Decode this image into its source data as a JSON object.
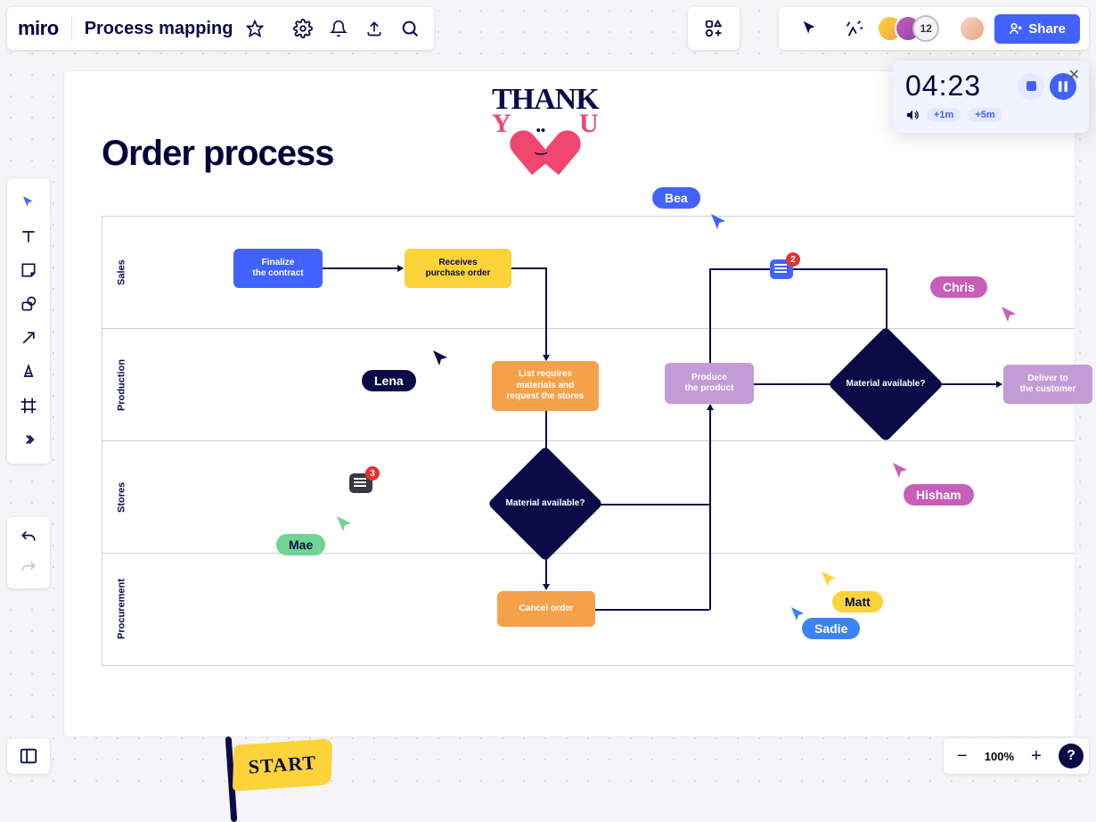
{
  "header": {
    "logo": "miro",
    "board_name": "Process mapping"
  },
  "collab": {
    "avatar_count": "12",
    "share_label": "Share"
  },
  "timer": {
    "digits": "04:23",
    "add1": "+1m",
    "add5": "+5m"
  },
  "zoom": {
    "percent": "100%"
  },
  "board": {
    "title": "Order process",
    "lanes": [
      "Sales",
      "Production",
      "Stores",
      "Procurement"
    ],
    "nodes": {
      "finalize": "Finalize\nthe contract",
      "receives": "Receives\npurchase order",
      "list_req": "List requires\nmaterials and\nrequest the stores",
      "mat_avail1": "Material\navailable?",
      "cancel": "Cancel order",
      "produce": "Produce\nthe product",
      "mat_avail2": "Material\navailable?",
      "deliver": "Deliver to\nthe customer"
    },
    "comments": {
      "c1_count": "3",
      "c2_count": "2"
    },
    "cursors": {
      "lena": "Lena",
      "mae": "Mae",
      "bea": "Bea",
      "chris": "Chris",
      "hisham": "Hisham",
      "sadie": "Sadie",
      "matt": "Matt"
    },
    "stickers": {
      "thank": "THANK",
      "y": "Y",
      "u": "U",
      "start": "START"
    }
  }
}
